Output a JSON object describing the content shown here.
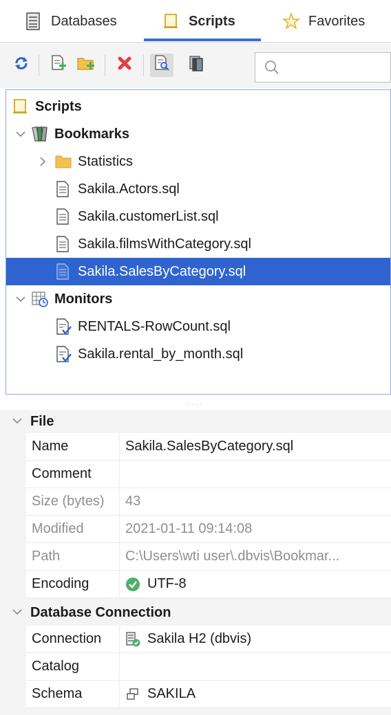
{
  "tabs": [
    {
      "label": "Databases",
      "icon": "database-icon"
    },
    {
      "label": "Scripts",
      "icon": "scripts-folder-icon",
      "active": true
    },
    {
      "label": "Favorites",
      "icon": "star-icon"
    }
  ],
  "toolbar": {
    "buttons": [
      "refresh-icon",
      "new-script-icon",
      "new-folder-icon",
      "delete-icon",
      "show-details-icon",
      "open-folder-icon"
    ],
    "search_value": "",
    "search_placeholder": ""
  },
  "tree": {
    "root": "Scripts",
    "bookmarks": {
      "label": "Bookmarks",
      "children": [
        {
          "label": "Statistics",
          "type": "folder"
        },
        {
          "label": "Sakila.Actors.sql",
          "type": "file"
        },
        {
          "label": "Sakila.customerList.sql",
          "type": "file"
        },
        {
          "label": "Sakila.filmsWithCategory.sql",
          "type": "file"
        },
        {
          "label": "Sakila.SalesByCategory.sql",
          "type": "file",
          "selected": true
        }
      ]
    },
    "monitors": {
      "label": "Monitors",
      "children": [
        {
          "label": "RENTALS-RowCount.sql"
        },
        {
          "label": "Sakila.rental_by_month.sql"
        }
      ]
    }
  },
  "splitter": "....",
  "properties": {
    "file": {
      "title": "File",
      "rows": [
        {
          "key": "Name",
          "value": "Sakila.SalesByCategory.sql"
        },
        {
          "key": "Comment",
          "value": ""
        },
        {
          "key": "Size (bytes)",
          "value": "43"
        },
        {
          "key": "Modified",
          "value": "2021-01-11 09:14:08"
        },
        {
          "key": "Path",
          "value": "C:\\Users\\wti user\\.dbvis\\Bookmar..."
        },
        {
          "key": "Encoding",
          "value": "UTF-8"
        }
      ]
    },
    "connection": {
      "title": "Database Connection",
      "rows": [
        {
          "key": "Connection",
          "value": "Sakila H2 (dbvis)"
        },
        {
          "key": "Catalog",
          "value": ""
        },
        {
          "key": "Schema",
          "value": "SAKILA"
        }
      ]
    }
  },
  "colors": {
    "accent": "#3a6fd0",
    "selection": "#2f64d0",
    "success": "#4caf6a"
  }
}
